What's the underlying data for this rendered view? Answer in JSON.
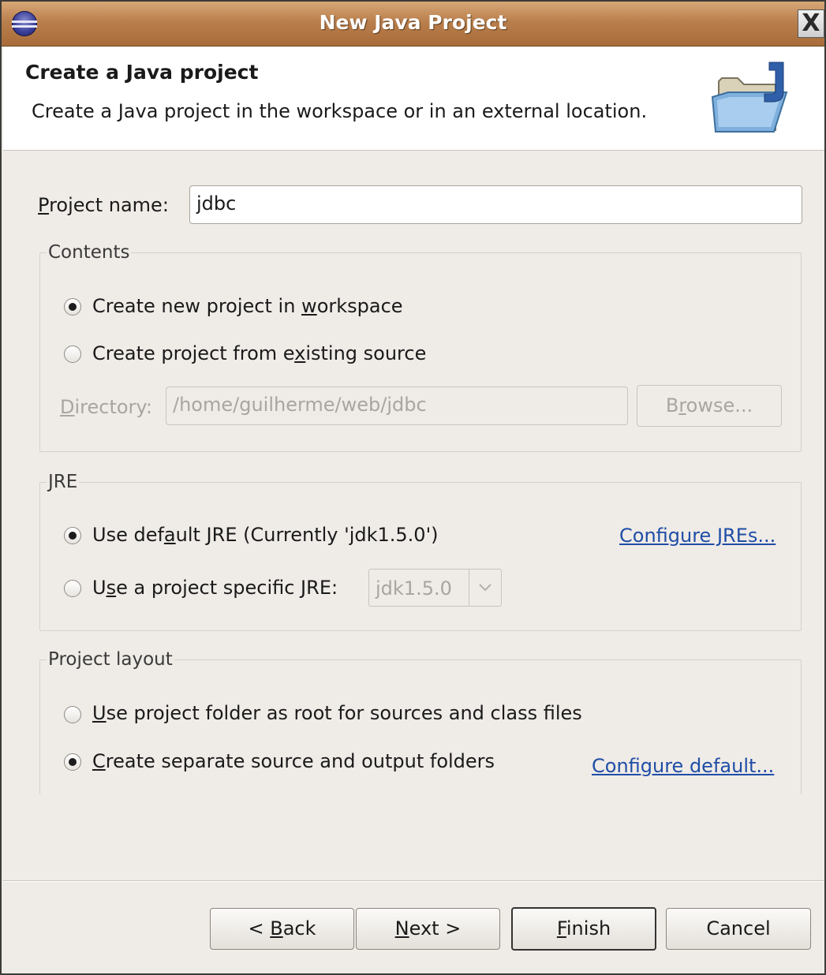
{
  "window": {
    "title": "New Java Project",
    "close_glyph": "X"
  },
  "banner": {
    "title": "Create a Java project",
    "description": "Create a Java project in the workspace or in an external location.",
    "icon": "java-project-folder-icon"
  },
  "project_name": {
    "label_mnemonic": "P",
    "label_rest": "roject name:",
    "value": "jdbc"
  },
  "contents": {
    "legend": "Contents",
    "option_new": {
      "pre": "Create new project in ",
      "mnemonic": "w",
      "post": "orkspace",
      "checked": true
    },
    "option_existing": {
      "pre": "Create project from e",
      "mnemonic": "x",
      "post": "isting source",
      "checked": false
    },
    "directory": {
      "label_mnemonic": "D",
      "label_rest": "irectory:",
      "value": "/home/guilherme/web/jdbc"
    },
    "browse": {
      "pre": "B",
      "mnemonic": "r",
      "post": "owse..."
    }
  },
  "jre": {
    "legend": "JRE",
    "option_default": {
      "pre": "Use def",
      "mnemonic": "a",
      "post": "ult JRE (Currently 'jdk1.5.0')",
      "checked": true
    },
    "configure_link": "Configure JREs...",
    "option_specific": {
      "pre": "U",
      "mnemonic": "s",
      "post": "e a project specific JRE:",
      "checked": false
    },
    "combo_value": "jdk1.5.0"
  },
  "layout": {
    "legend": "Project layout",
    "option_root": {
      "mnemonic": "U",
      "post": "se project folder as root for sources and class files",
      "checked": false
    },
    "option_separate": {
      "mnemonic": "C",
      "post": "reate separate source and output folders",
      "checked": true
    },
    "configure_link": "Configure default..."
  },
  "buttons": {
    "back": {
      "pre": "< ",
      "mnemonic": "B",
      "post": "ack"
    },
    "next": {
      "mnemonic": "N",
      "post": "ext >"
    },
    "finish": {
      "mnemonic": "F",
      "post": "inish"
    },
    "cancel": "Cancel"
  }
}
